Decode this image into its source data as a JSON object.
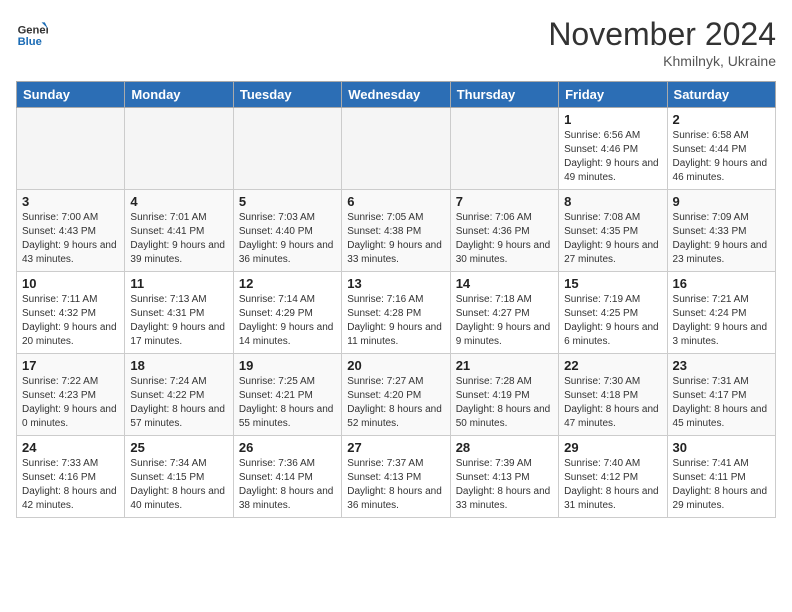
{
  "header": {
    "logo_general": "General",
    "logo_blue": "Blue",
    "month_title": "November 2024",
    "location": "Khmilnyk, Ukraine"
  },
  "weekdays": [
    "Sunday",
    "Monday",
    "Tuesday",
    "Wednesday",
    "Thursday",
    "Friday",
    "Saturday"
  ],
  "weeks": [
    [
      {
        "day": "",
        "info": ""
      },
      {
        "day": "",
        "info": ""
      },
      {
        "day": "",
        "info": ""
      },
      {
        "day": "",
        "info": ""
      },
      {
        "day": "",
        "info": ""
      },
      {
        "day": "1",
        "info": "Sunrise: 6:56 AM\nSunset: 4:46 PM\nDaylight: 9 hours and 49 minutes."
      },
      {
        "day": "2",
        "info": "Sunrise: 6:58 AM\nSunset: 4:44 PM\nDaylight: 9 hours and 46 minutes."
      }
    ],
    [
      {
        "day": "3",
        "info": "Sunrise: 7:00 AM\nSunset: 4:43 PM\nDaylight: 9 hours and 43 minutes."
      },
      {
        "day": "4",
        "info": "Sunrise: 7:01 AM\nSunset: 4:41 PM\nDaylight: 9 hours and 39 minutes."
      },
      {
        "day": "5",
        "info": "Sunrise: 7:03 AM\nSunset: 4:40 PM\nDaylight: 9 hours and 36 minutes."
      },
      {
        "day": "6",
        "info": "Sunrise: 7:05 AM\nSunset: 4:38 PM\nDaylight: 9 hours and 33 minutes."
      },
      {
        "day": "7",
        "info": "Sunrise: 7:06 AM\nSunset: 4:36 PM\nDaylight: 9 hours and 30 minutes."
      },
      {
        "day": "8",
        "info": "Sunrise: 7:08 AM\nSunset: 4:35 PM\nDaylight: 9 hours and 27 minutes."
      },
      {
        "day": "9",
        "info": "Sunrise: 7:09 AM\nSunset: 4:33 PM\nDaylight: 9 hours and 23 minutes."
      }
    ],
    [
      {
        "day": "10",
        "info": "Sunrise: 7:11 AM\nSunset: 4:32 PM\nDaylight: 9 hours and 20 minutes."
      },
      {
        "day": "11",
        "info": "Sunrise: 7:13 AM\nSunset: 4:31 PM\nDaylight: 9 hours and 17 minutes."
      },
      {
        "day": "12",
        "info": "Sunrise: 7:14 AM\nSunset: 4:29 PM\nDaylight: 9 hours and 14 minutes."
      },
      {
        "day": "13",
        "info": "Sunrise: 7:16 AM\nSunset: 4:28 PM\nDaylight: 9 hours and 11 minutes."
      },
      {
        "day": "14",
        "info": "Sunrise: 7:18 AM\nSunset: 4:27 PM\nDaylight: 9 hours and 9 minutes."
      },
      {
        "day": "15",
        "info": "Sunrise: 7:19 AM\nSunset: 4:25 PM\nDaylight: 9 hours and 6 minutes."
      },
      {
        "day": "16",
        "info": "Sunrise: 7:21 AM\nSunset: 4:24 PM\nDaylight: 9 hours and 3 minutes."
      }
    ],
    [
      {
        "day": "17",
        "info": "Sunrise: 7:22 AM\nSunset: 4:23 PM\nDaylight: 9 hours and 0 minutes."
      },
      {
        "day": "18",
        "info": "Sunrise: 7:24 AM\nSunset: 4:22 PM\nDaylight: 8 hours and 57 minutes."
      },
      {
        "day": "19",
        "info": "Sunrise: 7:25 AM\nSunset: 4:21 PM\nDaylight: 8 hours and 55 minutes."
      },
      {
        "day": "20",
        "info": "Sunrise: 7:27 AM\nSunset: 4:20 PM\nDaylight: 8 hours and 52 minutes."
      },
      {
        "day": "21",
        "info": "Sunrise: 7:28 AM\nSunset: 4:19 PM\nDaylight: 8 hours and 50 minutes."
      },
      {
        "day": "22",
        "info": "Sunrise: 7:30 AM\nSunset: 4:18 PM\nDaylight: 8 hours and 47 minutes."
      },
      {
        "day": "23",
        "info": "Sunrise: 7:31 AM\nSunset: 4:17 PM\nDaylight: 8 hours and 45 minutes."
      }
    ],
    [
      {
        "day": "24",
        "info": "Sunrise: 7:33 AM\nSunset: 4:16 PM\nDaylight: 8 hours and 42 minutes."
      },
      {
        "day": "25",
        "info": "Sunrise: 7:34 AM\nSunset: 4:15 PM\nDaylight: 8 hours and 40 minutes."
      },
      {
        "day": "26",
        "info": "Sunrise: 7:36 AM\nSunset: 4:14 PM\nDaylight: 8 hours and 38 minutes."
      },
      {
        "day": "27",
        "info": "Sunrise: 7:37 AM\nSunset: 4:13 PM\nDaylight: 8 hours and 36 minutes."
      },
      {
        "day": "28",
        "info": "Sunrise: 7:39 AM\nSunset: 4:13 PM\nDaylight: 8 hours and 33 minutes."
      },
      {
        "day": "29",
        "info": "Sunrise: 7:40 AM\nSunset: 4:12 PM\nDaylight: 8 hours and 31 minutes."
      },
      {
        "day": "30",
        "info": "Sunrise: 7:41 AM\nSunset: 4:11 PM\nDaylight: 8 hours and 29 minutes."
      }
    ]
  ]
}
